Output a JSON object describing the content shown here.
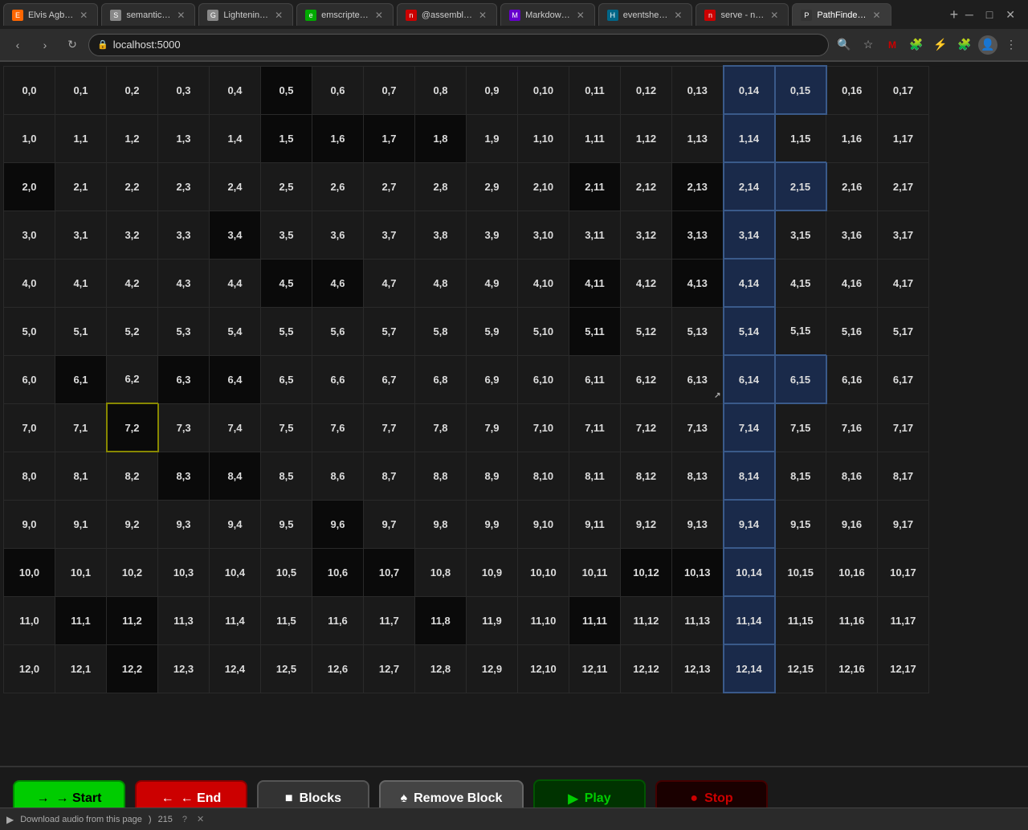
{
  "browser": {
    "tabs": [
      {
        "id": "tab1",
        "label": "Elvis Agb…",
        "favicon_class": "fav-orange",
        "favicon_text": "E",
        "active": false
      },
      {
        "id": "tab2",
        "label": "semantic…",
        "favicon_class": "fav-grey",
        "favicon_text": "S",
        "active": false
      },
      {
        "id": "tab3",
        "label": "Lightenin…",
        "favicon_class": "fav-grey",
        "favicon_text": "G",
        "active": false
      },
      {
        "id": "tab4",
        "label": "emscripte…",
        "favicon_class": "fav-green",
        "favicon_text": "e",
        "active": false
      },
      {
        "id": "tab5",
        "label": "@assembl…",
        "favicon_class": "fav-red",
        "favicon_text": "n",
        "active": false
      },
      {
        "id": "tab6",
        "label": "Markdow…",
        "favicon_class": "fav-purple",
        "favicon_text": "M",
        "active": false
      },
      {
        "id": "tab7",
        "label": "eventshe…",
        "favicon_class": "fav-teal",
        "favicon_text": "H",
        "active": false
      },
      {
        "id": "tab8",
        "label": "serve - n…",
        "favicon_class": "fav-red",
        "favicon_text": "n",
        "active": false
      },
      {
        "id": "tab9",
        "label": "PathFinde…",
        "favicon_class": "fav-dark",
        "favicon_text": "P",
        "active": true
      }
    ],
    "url": "localhost:5000",
    "new_tab_label": "+"
  },
  "toolbar": {
    "start_label": "→ Start",
    "end_label": "← End",
    "blocks_label": "■ Blocks",
    "remove_label": "♠ Remove Block",
    "play_label": "▶ Play",
    "stop_label": "● Stop"
  },
  "download": {
    "text": "Download audio from this page",
    "count": "215"
  },
  "grid": {
    "rows": 13,
    "cols": 18,
    "dark_cells": [
      "0,5",
      "1,5",
      "1,6",
      "1,7",
      "1,8",
      "2,0",
      "2,11",
      "2,13",
      "3,4",
      "3,13",
      "4,5",
      "4,6",
      "4,11",
      "4,13",
      "5,11",
      "6,1",
      "6,3",
      "6,4",
      "7,2",
      "8,3",
      "8,4",
      "9,6",
      "10,0",
      "10,6",
      "10,7",
      "10,12",
      "10,13",
      "11,1",
      "11,2",
      "11,8",
      "11,11",
      "12,2"
    ],
    "highlight_cells": [
      "0,14",
      "0,15",
      "1,14",
      "2,14",
      "2,15",
      "3,14",
      "4,14",
      "5,14",
      "6,14",
      "6,15",
      "7,14",
      "8,14",
      "9,14",
      "10,14",
      "11,14",
      "12,14"
    ],
    "yellow_border_cells": [
      "7,2"
    ],
    "cursor_cell": "6,13"
  }
}
